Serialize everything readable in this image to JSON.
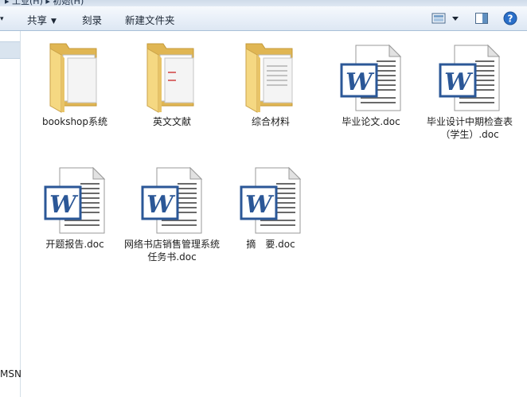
{
  "breadcrumb": "▸ 工业(H) ▸ 初始(H)",
  "toolbar": {
    "share_label": "共享",
    "burn_label": "刻录",
    "new_folder_label": "新建文件夹"
  },
  "nav": {
    "visible_text": "MSN"
  },
  "files": [
    {
      "name": "bookshop系统",
      "type": "folder",
      "icon": "folder-icon"
    },
    {
      "name": "英文文献",
      "type": "folder",
      "icon": "folder-icon"
    },
    {
      "name": "综合材料",
      "type": "folder",
      "icon": "folder-icon"
    },
    {
      "name": "毕业论文.doc",
      "type": "doc",
      "icon": "word-doc-icon"
    },
    {
      "name": "毕业设计中期检查表（学生）.doc",
      "type": "doc",
      "icon": "word-doc-icon"
    },
    {
      "name": "开题报告.doc",
      "type": "doc",
      "icon": "word-doc-icon"
    },
    {
      "name": "网络书店销售管理系统任务书.doc",
      "type": "doc",
      "icon": "word-doc-icon"
    },
    {
      "name": "摘　要.doc",
      "type": "doc",
      "icon": "word-doc-icon"
    }
  ],
  "colors": {
    "toolbar_bg": "#e8eff8",
    "word_blue": "#2b5797",
    "folder_yellow": "#f3d27a"
  }
}
